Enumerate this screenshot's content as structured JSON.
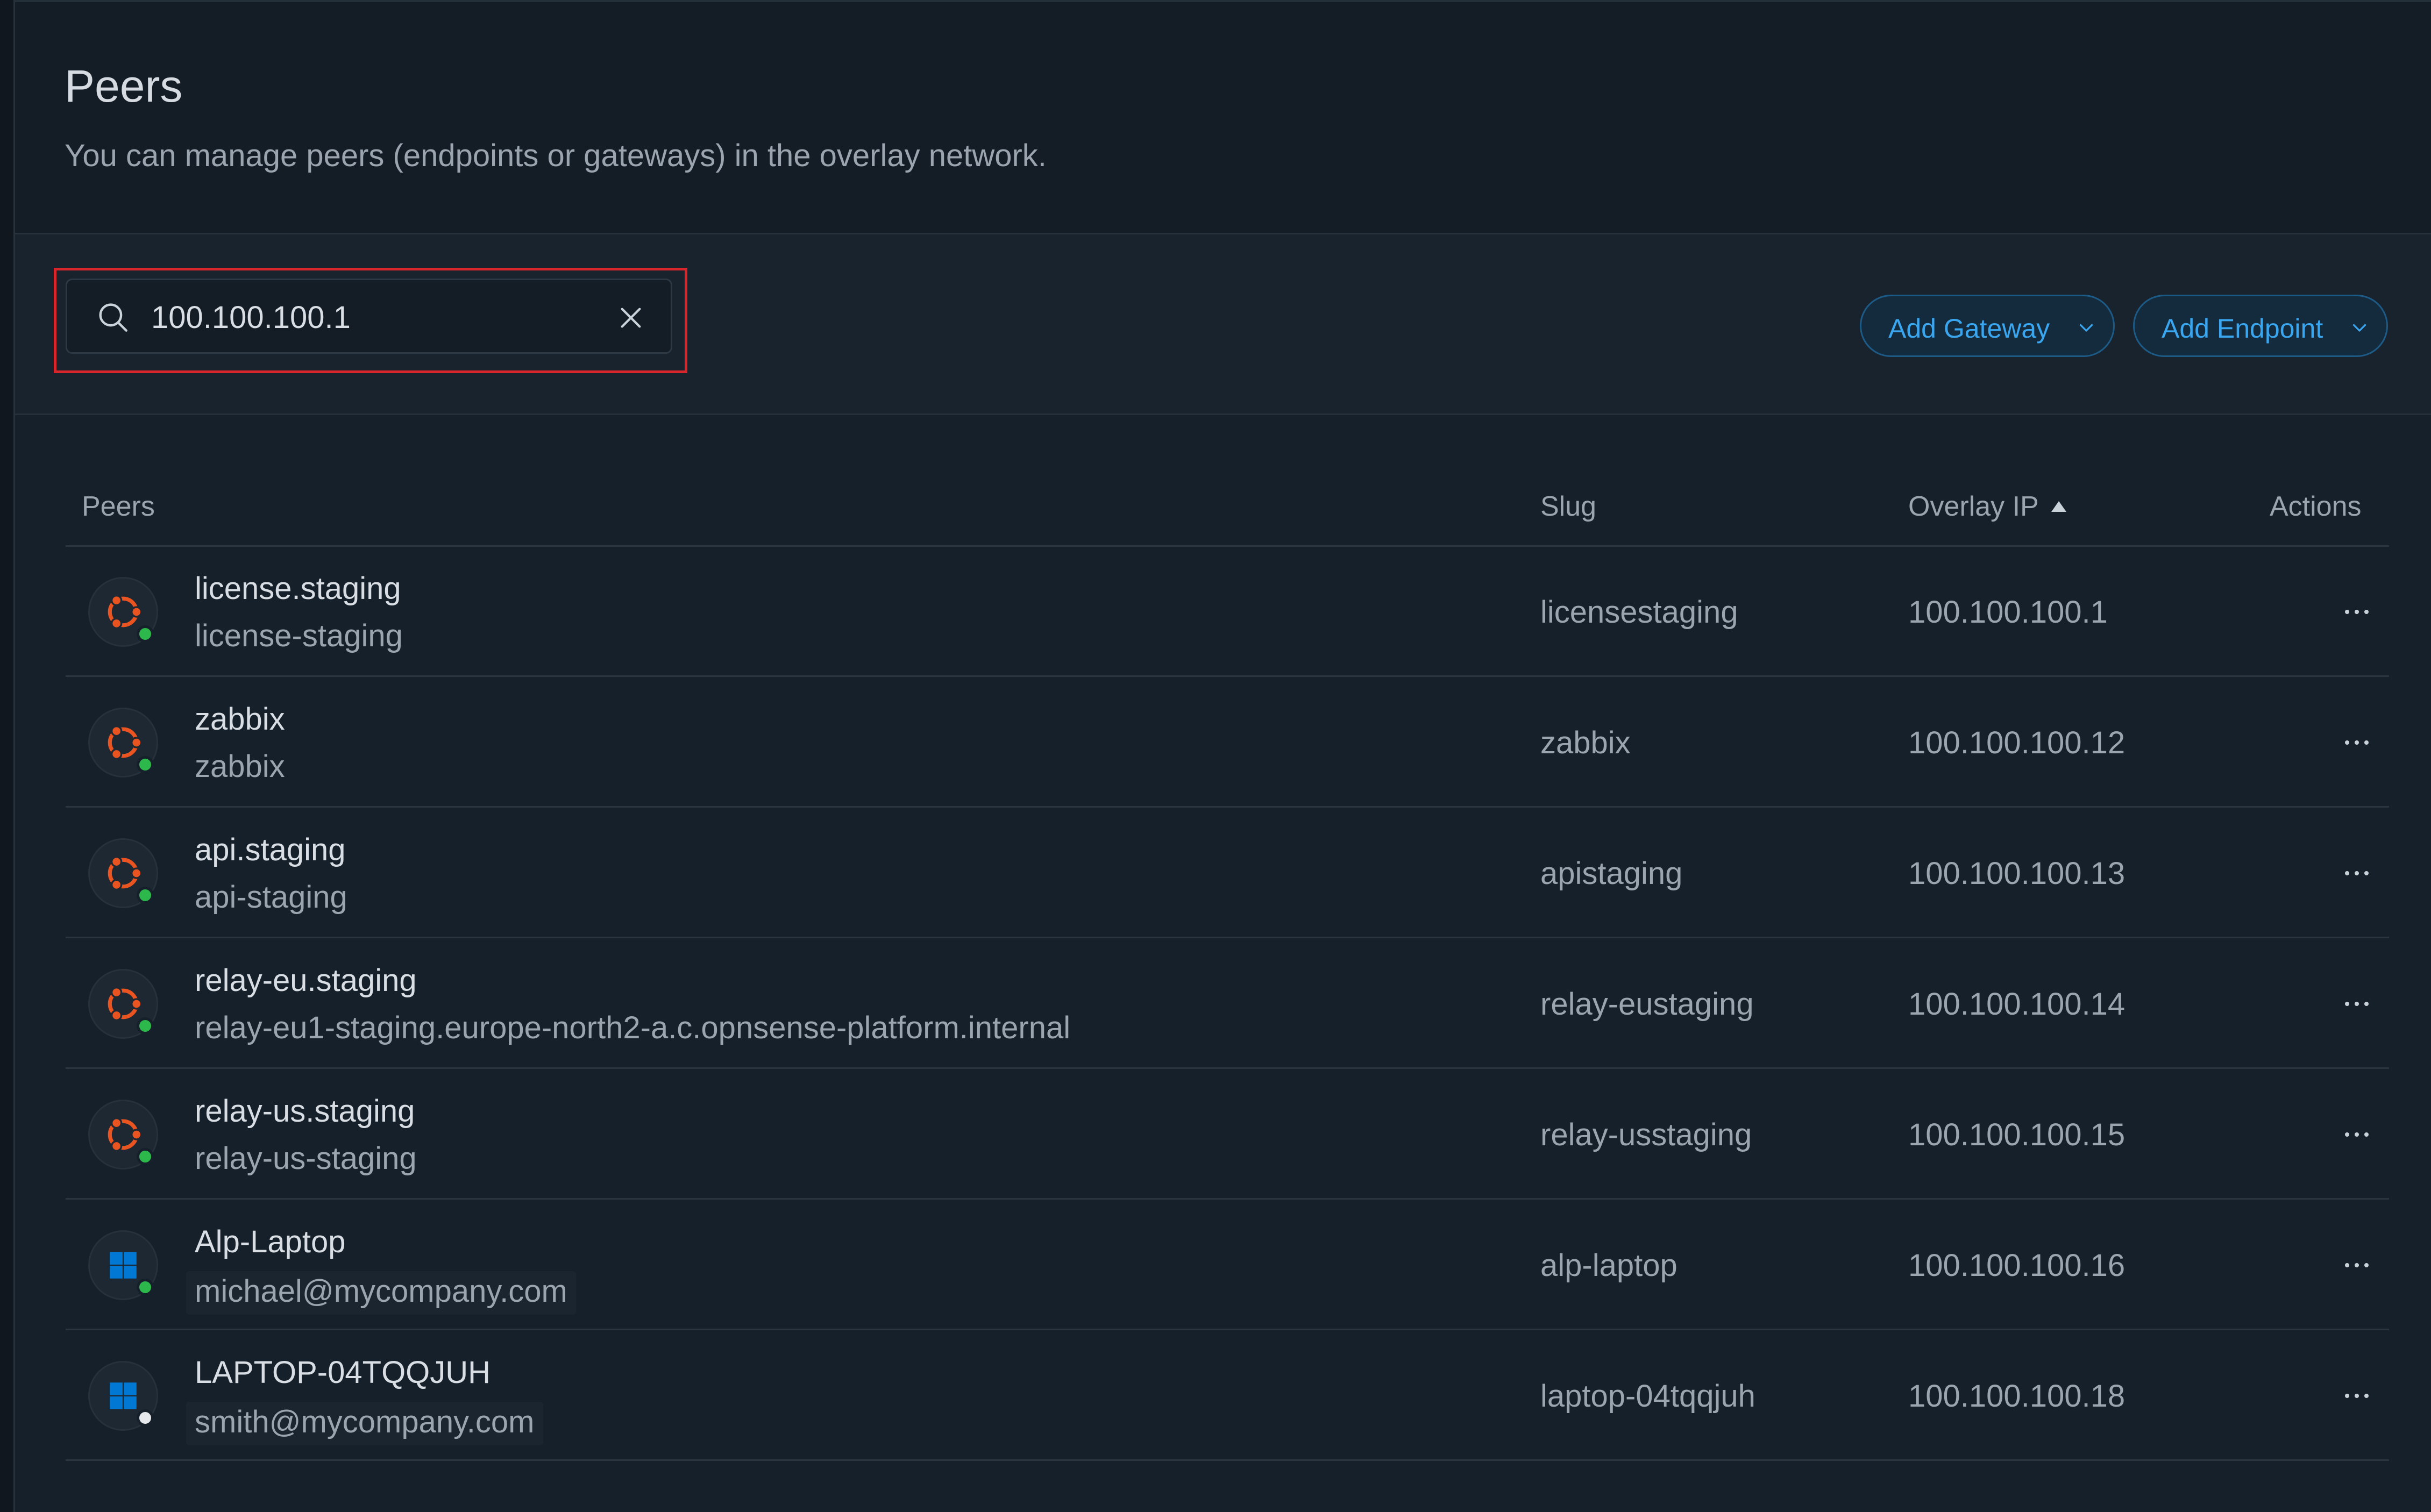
{
  "header": {
    "title": "Peers",
    "subtitle": "You can manage peers (endpoints or gateways) in the overlay network."
  },
  "toolbar": {
    "search": {
      "value": "100.100.100.1",
      "icon": "search-icon",
      "clear_icon": "close-icon"
    },
    "add_gateway_label": "Add Gateway",
    "add_endpoint_label": "Add Endpoint"
  },
  "table": {
    "columns": {
      "peers": "Peers",
      "slug": "Slug",
      "overlay_ip": "Overlay IP",
      "actions": "Actions"
    },
    "sort": {
      "column": "overlay_ip",
      "direction": "ascending"
    },
    "rows": [
      {
        "name": "license.staging",
        "subtitle": "license-staging",
        "slug": "licensestaging",
        "ip": "100.100.100.1",
        "os": "ubuntu",
        "status": "online"
      },
      {
        "name": "zabbix",
        "subtitle": "zabbix",
        "slug": "zabbix",
        "ip": "100.100.100.12",
        "os": "ubuntu",
        "status": "online"
      },
      {
        "name": "api.staging",
        "subtitle": "api-staging",
        "slug": "apistaging",
        "ip": "100.100.100.13",
        "os": "ubuntu",
        "status": "online"
      },
      {
        "name": "relay-eu.staging",
        "subtitle": "relay-eu1-staging.europe-north2-a.c.opnsense-platform.internal",
        "slug": "relay-eustaging",
        "ip": "100.100.100.14",
        "os": "ubuntu",
        "status": "online"
      },
      {
        "name": "relay-us.staging",
        "subtitle": "relay-us-staging",
        "slug": "relay-usstaging",
        "ip": "100.100.100.15",
        "os": "ubuntu",
        "status": "online"
      },
      {
        "name": "Alp-Laptop",
        "subtitle": "michael@mycompany.com",
        "slug": "alp-laptop",
        "ip": "100.100.100.16",
        "os": "windows",
        "status": "online"
      },
      {
        "name": "LAPTOP-04TQQJUH",
        "subtitle": "smith@mycompany.com",
        "slug": "laptop-04tqqjuh",
        "ip": "100.100.100.18",
        "os": "windows",
        "status": "offline"
      }
    ]
  },
  "colors": {
    "accent": "#3aa6f0",
    "highlight": "#d7262c",
    "ubuntu": "#e95420",
    "windows": "#0078d4",
    "online": "#2db84c",
    "offline": "#e6e9ec"
  }
}
